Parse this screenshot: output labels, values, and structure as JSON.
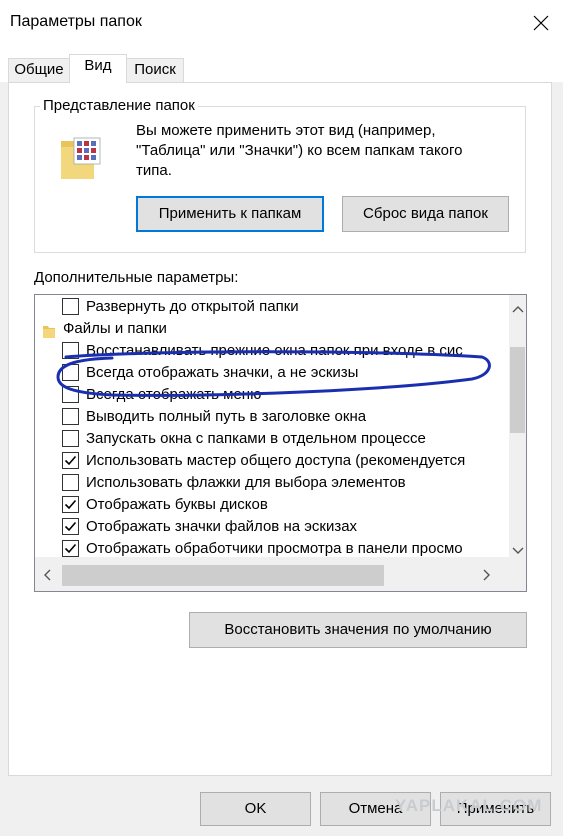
{
  "window": {
    "title": "Параметры папок",
    "close_icon": "close-icon"
  },
  "tabs": [
    {
      "label": "Общие",
      "active": false
    },
    {
      "label": "Вид",
      "active": true
    },
    {
      "label": "Поиск",
      "active": false
    }
  ],
  "folder_views": {
    "legend": "Представление папок",
    "description": "Вы можете применить этот вид (например, \"Таблица\" или \"Значки\") ко всем папкам такого типа.",
    "apply_button": "Применить к папкам",
    "reset_button": "Сброс вида папок"
  },
  "advanced": {
    "label": "Дополнительные параметры:",
    "items": [
      {
        "text": "Развернуть до открытой папки",
        "type": "checkbox",
        "checked": false
      },
      {
        "text": "Файлы и папки",
        "type": "folder"
      },
      {
        "text": "Восстанавливать прежние окна папок при входе в сис",
        "type": "checkbox",
        "checked": false
      },
      {
        "text": "Всегда отображать значки, а не эскизы",
        "type": "checkbox",
        "checked": false
      },
      {
        "text": "Всегда отображать меню",
        "type": "checkbox",
        "checked": false
      },
      {
        "text": "Выводить полный путь в заголовке окна",
        "type": "checkbox",
        "checked": false
      },
      {
        "text": "Запускать окна с папками в отдельном процессе",
        "type": "checkbox",
        "checked": false
      },
      {
        "text": "Использовать мастер общего доступа (рекомендуется",
        "type": "checkbox",
        "checked": true
      },
      {
        "text": "Использовать флажки для выбора элементов",
        "type": "checkbox",
        "checked": false
      },
      {
        "text": "Отображать буквы дисков",
        "type": "checkbox",
        "checked": true
      },
      {
        "text": "Отображать значки файлов на эскизах",
        "type": "checkbox",
        "checked": true
      },
      {
        "text": "Отображать обработчики просмотра в панели просмо",
        "type": "checkbox",
        "checked": true
      }
    ],
    "restore_button": "Восстановить значения по умолчанию"
  },
  "footer": {
    "ok": "OK",
    "cancel": "Отмена",
    "apply": "Применить"
  },
  "watermark": "YAPLAKAL.COM",
  "colors": {
    "accent": "#0078d7",
    "highlight_ink": "#1a2fb0"
  }
}
